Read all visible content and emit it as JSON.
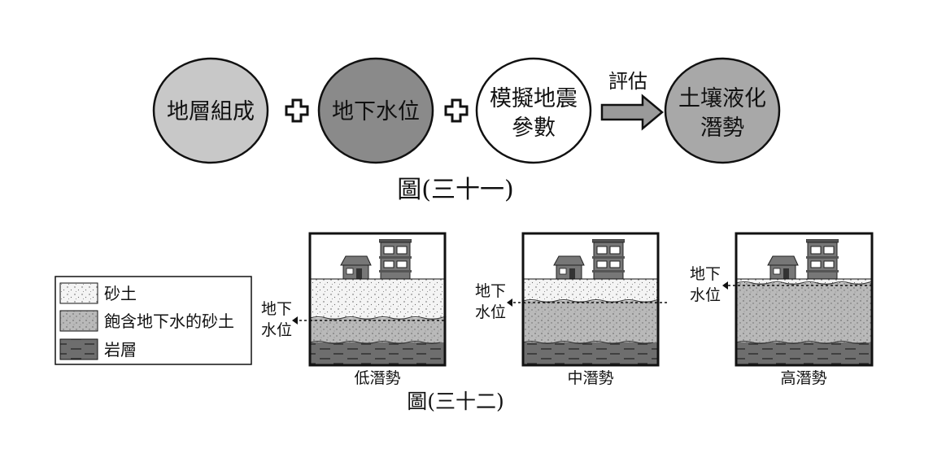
{
  "figure31": {
    "circles": [
      {
        "line1": "地層組成",
        "line2": "",
        "fill": "#c8c8c8"
      },
      {
        "line1": "地下水位",
        "line2": "",
        "fill": "#8a8a8a"
      },
      {
        "line1": "模擬地震",
        "line2": "參數",
        "fill": "#ffffff"
      },
      {
        "line1": "土壤液化",
        "line2": "潛勢",
        "fill": "#a8a8a8"
      }
    ],
    "arrow_label": "評估",
    "caption": "圖(三十一)"
  },
  "figure32": {
    "legend": [
      {
        "label": "砂土",
        "pattern": "sand"
      },
      {
        "label": "飽含地下水的砂土",
        "pattern": "wet"
      },
      {
        "label": "岩層",
        "pattern": "rock"
      }
    ],
    "water_label_line1": "地下",
    "water_label_line2": "水位",
    "panels": [
      {
        "caption": "低潛勢"
      },
      {
        "caption": "中潛勢"
      },
      {
        "caption": "高潛勢"
      }
    ],
    "caption": "圖(三十二)"
  },
  "colors": {
    "sand": "#f4f4f4",
    "wet": "#b9b9b9",
    "rock": "#6e6e6e",
    "building": "#777777",
    "outline": "#111111"
  }
}
